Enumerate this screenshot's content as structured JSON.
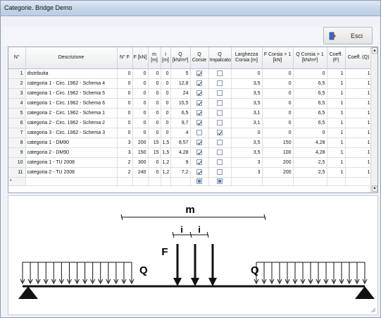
{
  "window": {
    "title": "Categorie. Bridge Demo"
  },
  "toolbar": {
    "exit_label": "Esci"
  },
  "grid": {
    "columns": [
      "N°",
      "Descrizione",
      "N° F",
      "F [kN]",
      "m [m]",
      "i [m]",
      "Q [kN/m²]",
      "Q Corsie",
      "Q Impalcato",
      "Larghezza Corsia [m]",
      "F Corsia > 1 [kN]",
      "Q Corsia > 1 [kN/m²]",
      "Coeff. (F)",
      "Coeff. (Q)"
    ],
    "rows": [
      {
        "n": "1",
        "desc": "distribuita",
        "nf": "0",
        "f": "0",
        "m": "0",
        "i": "0",
        "q": "5",
        "qc": true,
        "qi": false,
        "larg": "0",
        "fc": "0",
        "qcor": "0",
        "cf": "1",
        "cq": "1"
      },
      {
        "n": "2",
        "desc": "categoria 1 - Circ. 1962 - Schema 4",
        "nf": "0",
        "f": "0",
        "m": "0",
        "i": "0",
        "q": "12,8",
        "qc": true,
        "qi": false,
        "larg": "3,5",
        "fc": "0",
        "qcor": "6,5",
        "cf": "1",
        "cq": "1"
      },
      {
        "n": "3",
        "desc": "categoria 1 - Circ. 1962 - Schema 5",
        "nf": "0",
        "f": "0",
        "m": "0",
        "i": "0",
        "q": "24",
        "qc": true,
        "qi": false,
        "larg": "3,5",
        "fc": "0",
        "qcor": "6,5",
        "cf": "1",
        "cq": "1"
      },
      {
        "n": "4",
        "desc": "categoria 1 - Circ. 1962 - Schema 6",
        "nf": "0",
        "f": "0",
        "m": "0",
        "i": "0",
        "q": "15,5",
        "qc": true,
        "qi": false,
        "larg": "3,5",
        "fc": "0",
        "qcor": "6,5",
        "cf": "1",
        "cq": "1"
      },
      {
        "n": "5",
        "desc": "categoria 2 - Circ. 1962 - Schema 1",
        "nf": "0",
        "f": "0",
        "m": "0",
        "i": "0",
        "q": "6,5",
        "qc": true,
        "qi": false,
        "larg": "3,1",
        "fc": "0",
        "qcor": "6,5",
        "cf": "1",
        "cq": "1"
      },
      {
        "n": "6",
        "desc": "categoria 2 - Circ. 1962 - Schema 2",
        "nf": "0",
        "f": "0",
        "m": "0",
        "i": "0",
        "q": "9,7",
        "qc": true,
        "qi": false,
        "larg": "3,1",
        "fc": "0",
        "qcor": "6,5",
        "cf": "1",
        "cq": "1"
      },
      {
        "n": "7",
        "desc": "categoria 3 - Circ. 1962 - Schema 3",
        "nf": "0",
        "f": "0",
        "m": "0",
        "i": "0",
        "q": "4",
        "qc": false,
        "qi": true,
        "larg": "0",
        "fc": "0",
        "qcor": "0",
        "cf": "1",
        "cq": "1"
      },
      {
        "n": "8",
        "desc": "categoria 1 - DM90",
        "nf": "3",
        "f": "200",
        "m": "15",
        "i": "1,5",
        "q": "8,57",
        "qc": true,
        "qi": false,
        "larg": "3,5",
        "fc": "150",
        "qcor": "4,28",
        "cf": "1",
        "cq": "1"
      },
      {
        "n": "9",
        "desc": "categoria 2 - DM90",
        "nf": "3",
        "f": "150",
        "m": "15",
        "i": "1,5",
        "q": "4,28",
        "qc": true,
        "qi": false,
        "larg": "3,5",
        "fc": "100",
        "qcor": "4,28",
        "cf": "1",
        "cq": "1"
      },
      {
        "n": "10",
        "desc": "categoria 1 - TU 2008",
        "nf": "2",
        "f": "300",
        "m": "0",
        "i": "1,2",
        "q": "9",
        "qc": true,
        "qi": false,
        "larg": "3",
        "fc": "200",
        "qcor": "2,5",
        "cf": "1",
        "cq": "1"
      },
      {
        "n": "11",
        "desc": "categoria 2 - TU 2008",
        "nf": "2",
        "f": "240",
        "m": "0",
        "i": "1,2",
        "q": "7,2",
        "qc": true,
        "qi": false,
        "larg": "3",
        "fc": "200",
        "qcor": "2,5",
        "cf": "1",
        "cq": "1"
      }
    ],
    "new_row_marker": "*"
  },
  "diagram": {
    "m_label": "m",
    "i_label_1": "i",
    "i_label_2": "i",
    "f_label": "F",
    "q_left_label": "Q",
    "q_right_label": "Q"
  },
  "icons": {
    "exit": "exit-door-icon",
    "scroll_up": "scroll-up-arrow-icon",
    "scroll_down": "scroll-down-arrow-icon",
    "resize": "resize-grip-icon"
  },
  "colors": {
    "accent": "#4a7bc0",
    "titlebar": "#c7d7ea",
    "exit_icon": "#2f6fc5"
  }
}
